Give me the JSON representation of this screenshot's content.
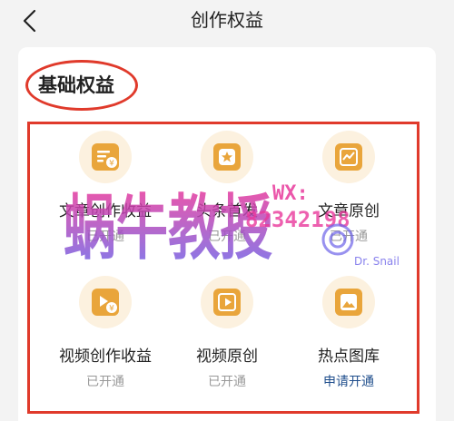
{
  "header": {
    "title": "创作权益",
    "back_icon": "chevron-left-icon"
  },
  "section": {
    "title": "基础权益"
  },
  "items": [
    {
      "label": "文章创作收益",
      "status": "已开通",
      "icon": "article-income-icon"
    },
    {
      "label": "头条首发",
      "status": "已开通",
      "icon": "star-icon"
    },
    {
      "label": "文章原创",
      "status": "已开通",
      "icon": "chart-icon"
    },
    {
      "label": "视频创作收益",
      "status": "已开通",
      "icon": "video-income-icon"
    },
    {
      "label": "视频原创",
      "status": "已开通",
      "icon": "play-icon"
    },
    {
      "label": "热点图库",
      "status": "申请开通",
      "icon": "image-icon"
    }
  ],
  "watermark": {
    "brand": "蜗牛教授",
    "wx_label": "WX:",
    "wx_number": "82342198",
    "english": "Dr. Snail"
  },
  "colors": {
    "accent_orange": "#e9a53b",
    "icon_bg": "#fcf1df",
    "highlight_red": "#e03a2b",
    "apply_blue": "#1f4e8c"
  }
}
